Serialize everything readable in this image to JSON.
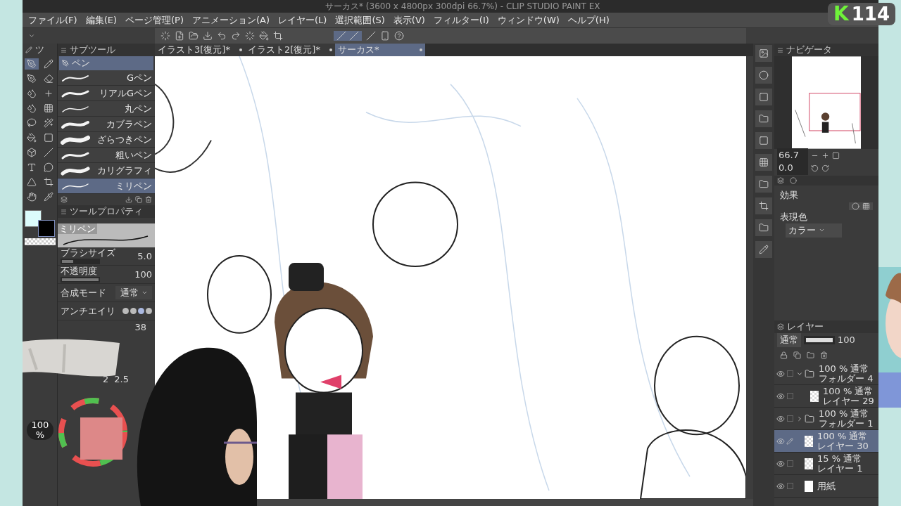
{
  "window": {
    "title": "サーカス* (3600 x 4800px 300dpi 66.7%) - CLIP STUDIO PAINT EX"
  },
  "menu": [
    "ファイル(F)",
    "編集(E)",
    "ページ管理(P)",
    "アニメーション(A)",
    "レイヤー(L)",
    "選択範囲(S)",
    "表示(V)",
    "フィルター(I)",
    "ウィンドウ(W)",
    "ヘルプ(H)"
  ],
  "doc_tabs": [
    {
      "label": "イラスト3[復元]*",
      "selected": false
    },
    {
      "label": "イラスト2[復元]*",
      "selected": false
    },
    {
      "label": "サーカス*",
      "selected": true
    }
  ],
  "tool_panel": {
    "tab": "ツ"
  },
  "subtool": {
    "tab": "サブツール",
    "group": "ペン",
    "brushes": [
      {
        "label": "Gペン",
        "selected": false
      },
      {
        "label": "リアルGペン",
        "selected": false
      },
      {
        "label": "丸ペン",
        "selected": false
      },
      {
        "label": "カブラペン",
        "selected": false
      },
      {
        "label": "ざらつきペン",
        "selected": false
      },
      {
        "label": "粗いペン",
        "selected": false
      },
      {
        "label": "カリグラフィ",
        "selected": false
      },
      {
        "label": "ミリペン",
        "selected": true
      }
    ]
  },
  "tool_property": {
    "tab": "ツールプロパティ",
    "preview_label": "ミリペン",
    "rows": [
      {
        "kind": "slider",
        "label": "ブラシサイズ",
        "value": "5.0",
        "level": 0.3
      },
      {
        "kind": "slider",
        "label": "不透明度",
        "value": "100",
        "level": 1
      },
      {
        "kind": "select",
        "label": "合成モード",
        "value": "通常"
      },
      {
        "kind": "shapes",
        "label": "アンチエイリ",
        "options": [
          {
            "selected": false
          },
          {
            "selected": false
          },
          {
            "selected": true
          },
          {
            "selected": false
          }
        ]
      }
    ],
    "partial_value": "38"
  },
  "brush_size_presets": [
    "2",
    "2.5"
  ],
  "color_slider": {
    "reading": "100 %"
  },
  "navigator": {
    "tab": "ナビゲータ",
    "zoom": "66.7",
    "rotation": "0.0"
  },
  "layer_property": {
    "effect_label": "効果",
    "color_label": "表現色",
    "color_mode": "カラー"
  },
  "layers_panel": {
    "tab": "レイヤー",
    "blend": "通常",
    "opacity": "100",
    "opacity_slider": {
      "level": 1
    },
    "layers": [
      {
        "kind": "folder",
        "mode": "100 % 通常",
        "name": "フォルダー 4",
        "expanded": true,
        "selected": false,
        "children": [
          {
            "kind": "layer",
            "mode": "100 % 通常",
            "name": "レイヤー 29",
            "selected": false
          }
        ]
      },
      {
        "kind": "folder",
        "mode": "100 % 通常",
        "name": "フォルダー 1",
        "expanded": false,
        "selected": false
      },
      {
        "kind": "layer",
        "mode": "100 % 通常",
        "name": "レイヤー 30",
        "selected": true
      },
      {
        "kind": "layer",
        "mode": "15 % 通常",
        "name": "レイヤー 1",
        "selected": false
      },
      {
        "kind": "paper",
        "name": "用紙",
        "selected": false
      }
    ]
  },
  "logo": {
    "letter": "K",
    "number": "114"
  }
}
